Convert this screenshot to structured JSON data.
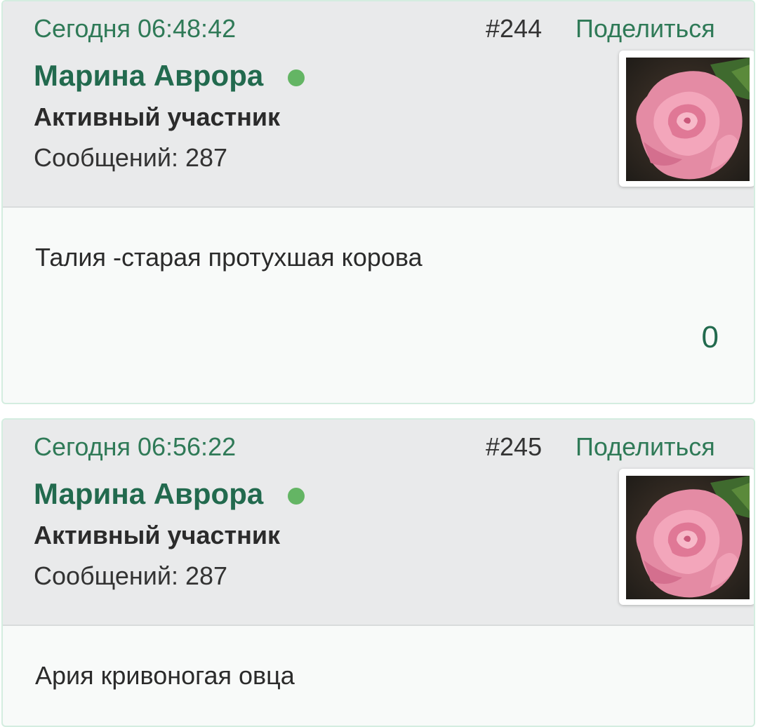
{
  "posts": [
    {
      "date": "Сегодня 06:48:42",
      "number": "#244",
      "share_label": "Поделиться",
      "author": "Марина Аврора",
      "role": "Активный участник",
      "messages": "Сообщений: 287",
      "text": "Талия -старая протухшая корова",
      "reactions": "0"
    },
    {
      "date": "Сегодня 06:56:22",
      "number": "#245",
      "share_label": "Поделиться",
      "author": "Марина Аврора",
      "role": "Активный участник",
      "messages": "Сообщений: 287",
      "text": "Ария кривоногая овца"
    }
  ],
  "colors": {
    "accent": "#2f7a57",
    "author": "#226a4e",
    "online": "#64b564",
    "header_bg": "#e9eaeb"
  }
}
